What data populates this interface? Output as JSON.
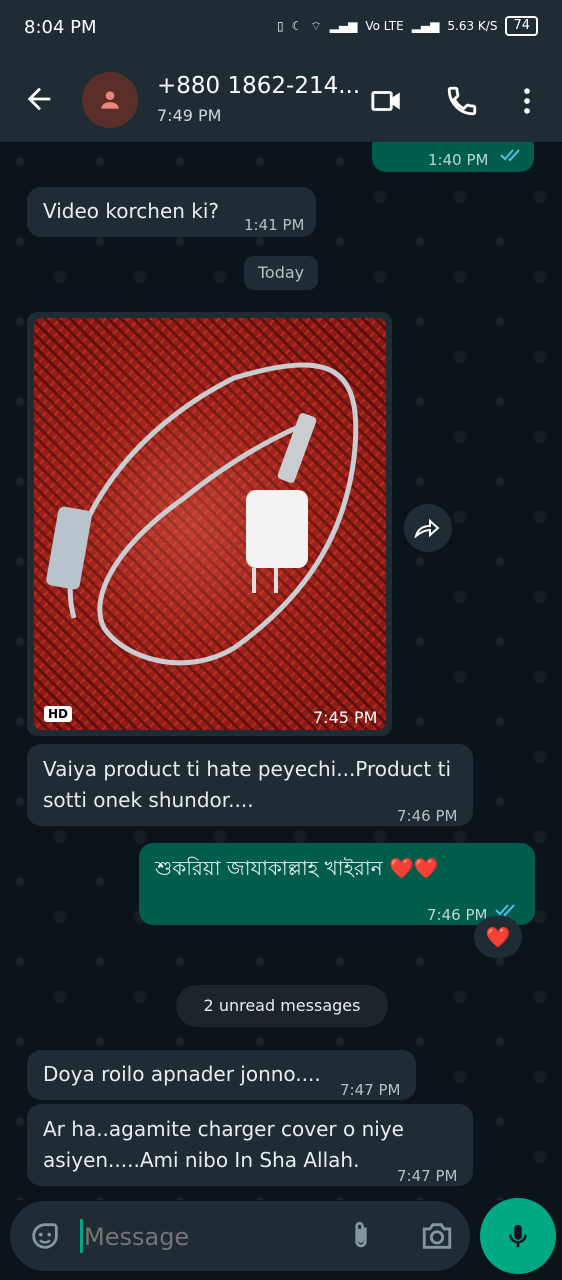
{
  "status_bar": {
    "time": "8:04 PM",
    "network": "Vo LTE",
    "speed": "5.63 K/S",
    "battery": "74"
  },
  "header": {
    "contact_name": "+880 1862-214...",
    "last_seen": "7:49 PM"
  },
  "messages": [
    {
      "direction": "out",
      "text": "",
      "time": "1:40 PM",
      "read": true
    },
    {
      "direction": "in",
      "text": "Video korchen ki?",
      "time": "1:41 PM"
    },
    {
      "direction": "in",
      "type": "photo",
      "badge": "HD",
      "time": "7:45 PM"
    },
    {
      "direction": "in",
      "text": "Vaiya product ti hate peyechi...Product ti sotti onek shundor....",
      "time": "7:46 PM"
    },
    {
      "direction": "out",
      "text": "শুকরিয়া জাযাকাল্লাহ খাইরান ❤️❤️",
      "time": "7:46 PM",
      "read": true,
      "reaction": "❤️"
    },
    {
      "direction": "in",
      "text": "Doya roilo apnader jonno....",
      "time": "7:47 PM"
    },
    {
      "direction": "in",
      "text": "Ar ha..agamite charger cover o niye asiyen.....Ami nibo In Sha Allah.",
      "time": "7:47 PM"
    }
  ],
  "date_separator": "Today",
  "unread_banner": "2 unread messages",
  "composer": {
    "placeholder": "Message"
  },
  "icons": {
    "back": "arrow-left-icon",
    "avatar": "person-icon",
    "video": "video-call-icon",
    "call": "phone-icon",
    "menu": "more-vert-icon",
    "forward": "forward-icon",
    "emoji": "sticker-icon",
    "attach": "paperclip-icon",
    "camera": "camera-icon",
    "mic": "mic-icon"
  },
  "colors": {
    "header": "#1f2c33",
    "incoming": "#1f2c33",
    "outgoing": "#005c4b",
    "accent": "#00a884",
    "read_ticks": "#53bdeb"
  }
}
